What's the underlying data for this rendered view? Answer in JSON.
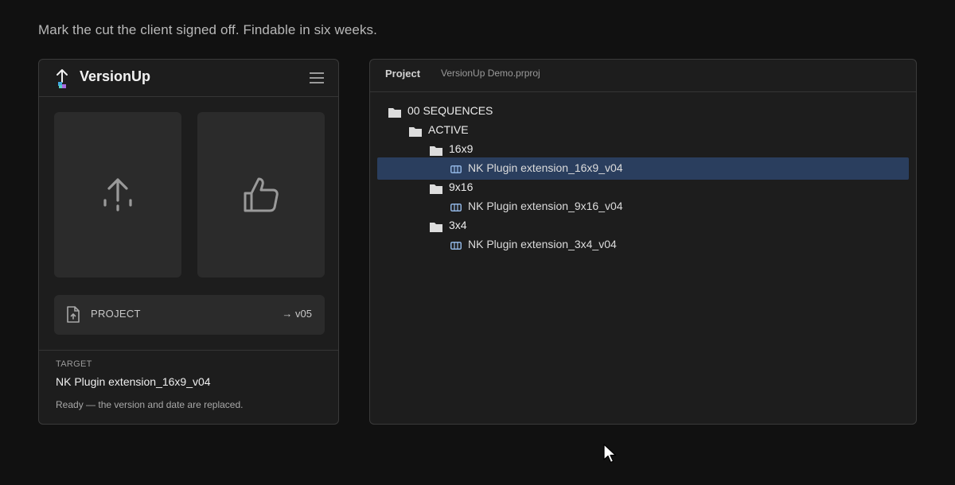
{
  "instruction": "Mark the cut the client signed off. Findable in six weeks.",
  "versionup": {
    "title": "VersionUp",
    "project_row": {
      "label": "PROJECT",
      "version": "→ v05"
    },
    "target": {
      "label": "TARGET",
      "name": "NK Plugin extension_16x9_v04",
      "status": "Ready — the version and date are replaced."
    }
  },
  "project_panel": {
    "tab": "Project",
    "file": "VersionUp Demo.prproj",
    "tree": [
      {
        "kind": "folder",
        "label": "00 SEQUENCES",
        "depth": 0,
        "selected": false
      },
      {
        "kind": "folder",
        "label": "ACTIVE",
        "depth": 1,
        "selected": false
      },
      {
        "kind": "folder",
        "label": "16x9",
        "depth": 2,
        "selected": false
      },
      {
        "kind": "sequence",
        "label": "NK Plugin extension_16x9_v04",
        "depth": 3,
        "selected": true
      },
      {
        "kind": "folder",
        "label": "9x16",
        "depth": 2,
        "selected": false
      },
      {
        "kind": "sequence",
        "label": "NK Plugin extension_9x16_v04",
        "depth": 3,
        "selected": false
      },
      {
        "kind": "folder",
        "label": "3x4",
        "depth": 2,
        "selected": false
      },
      {
        "kind": "sequence",
        "label": "NK Plugin extension_3x4_v04",
        "depth": 3,
        "selected": false
      }
    ]
  },
  "colors": {
    "background": "#111111",
    "panel": "#1d1d1d",
    "tile": "#2b2b2b",
    "selection": "#2a3e5e",
    "sequence_icon": "#8fb3e0"
  },
  "icons": {
    "logo": "versionup-logo-icon",
    "menu": "hamburger-menu-icon",
    "version_up": "arrow-up-icon",
    "approve": "thumbs-up-icon",
    "project_file": "project-file-icon",
    "folder": "folder-icon",
    "sequence": "sequence-icon",
    "cursor": "mouse-pointer-icon"
  }
}
